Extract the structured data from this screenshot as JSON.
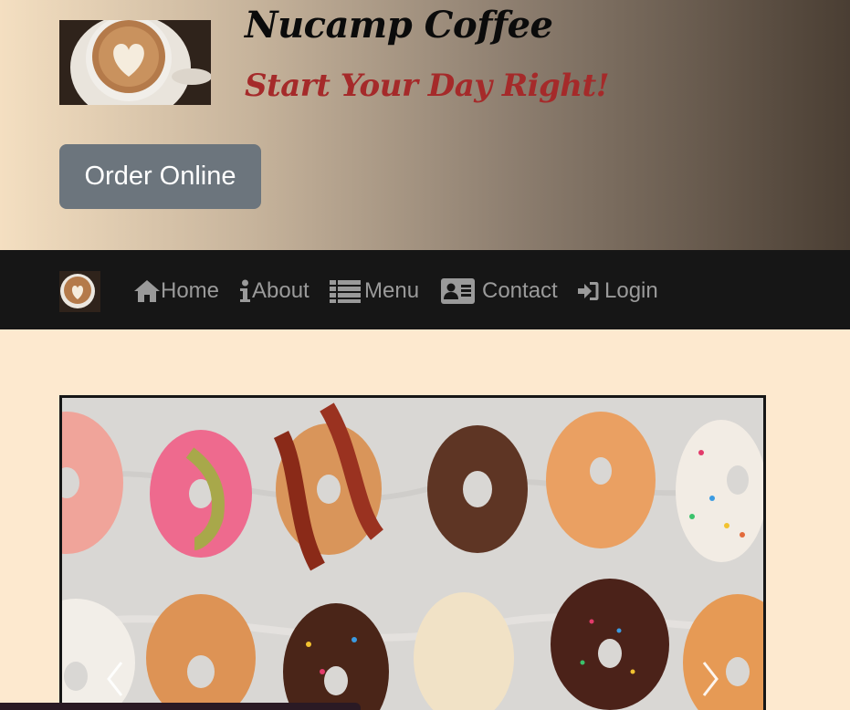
{
  "header": {
    "title": "Nucamp Coffee",
    "tagline": "Start Your Day Right!",
    "logo_icon": "latte-art-icon",
    "order_button": "Order Online"
  },
  "nav": {
    "items": [
      {
        "label": "Home",
        "icon": "home-icon"
      },
      {
        "label": "About",
        "icon": "info-icon"
      },
      {
        "label": "Menu",
        "icon": "list-icon"
      },
      {
        "label": "Contact",
        "icon": "address-card-icon"
      },
      {
        "label": "Login",
        "icon": "sign-in-icon"
      }
    ]
  },
  "carousel": {
    "image": "donuts-photo",
    "prev_icon": "chevron-left-icon",
    "next_icon": "chevron-right-icon"
  },
  "colors": {
    "page_background": "#fde9cf",
    "navbar_background": "#161616",
    "tagline": "#a52a2a",
    "button": "#6c757d"
  }
}
